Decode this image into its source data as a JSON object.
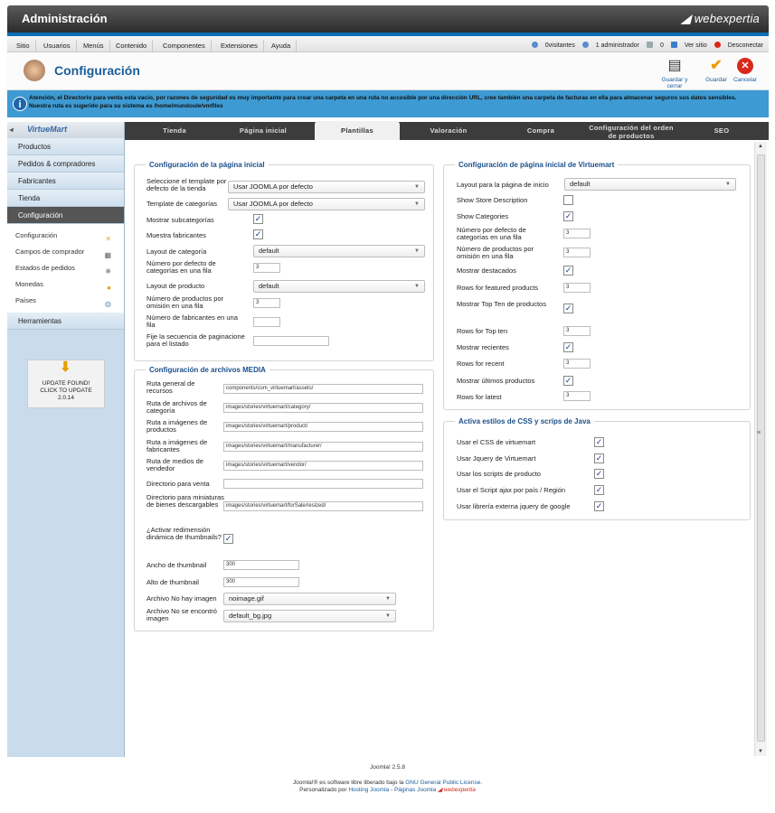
{
  "header": {
    "title": "Administración",
    "brand": "webexpertia"
  },
  "menu": {
    "items": [
      "Sitio",
      "Usuarios",
      "Menús",
      "Contenido",
      "Componentes",
      "Extensiones",
      "Ayuda"
    ],
    "visitors": "0visitantes",
    "admins": "1 administrador",
    "messages": "0",
    "view_site": "Ver sitio",
    "logout": "Desconectar"
  },
  "toolbar": {
    "title": "Configuración",
    "save_close": "Guardar y cerrar",
    "save": "Guardar",
    "cancel": "Cancelar"
  },
  "alert": {
    "text": "Atención, el Directorio para venta esta vacío, por razones de seguridad es muy importante para crear una carpeta en una ruta no accesible por una dirección URL, cree también una carpeta de facturas en ella para almacenar seguros sus datos sensibles. Nuestra ruta es sugerido para su sistema es /home/mundoule/vmfiles"
  },
  "sidebar": {
    "logo": "VirtueMart",
    "items": [
      "Productos",
      "Pedidos & compradores",
      "Fabricantes",
      "Tienda",
      "Configuración"
    ],
    "sub": [
      "Configuración",
      "Campos de comprador",
      "Estados de pedidos",
      "Monedas",
      "Países"
    ],
    "tools": "Herramientas",
    "update": {
      "line1": "UPDATE FOUND!",
      "line2": "CLICK TO UPDATE",
      "version": "2.0.14"
    }
  },
  "tabs": [
    "Tienda",
    "Página inicial",
    "Plantillas",
    "Valoración",
    "Compra",
    "Configuración del orden de productos",
    "SEO"
  ],
  "left": {
    "legend1": "Configuración de la página inicial",
    "store_template_label": "Seleccione el template por defecto de la tienda",
    "store_template_value": "Usar JOOMLA por defecto",
    "cat_template_label": "Template de categorías",
    "cat_template_value": "Usar JOOMLA por defecto",
    "show_subcats": "Mostrar subcategorías",
    "show_manufacturers": "Muestra fabricantes",
    "cat_layout_label": "Layout de categoría",
    "cat_layout_value": "default",
    "cats_per_row_label": "Número por defecto de categorías en una fila",
    "cats_per_row_value": "3",
    "product_layout_label": "Layout de producto",
    "product_layout_value": "default",
    "products_per_row_label": "Número de productos por omisión en una fila",
    "products_per_row_value": "3",
    "manu_per_row_label": "Número de fabricantes en una fila",
    "manu_per_row_value": "",
    "pagination_label": "Fije la secuencia de paginacione para el listado",
    "pagination_value": "",
    "legend2": "Configuración de archivos MEDIA",
    "assets_label": "Ruta general de recursos",
    "assets_value": "components/com_virtuemart/assets/",
    "cat_images_label": "Ruta de archivos de categoría",
    "cat_images_value": "images/stories/virtuemart/category/",
    "prod_images_label": "Ruta a imágenes de productos",
    "prod_images_value": "images/stories/virtuemart/product/",
    "manu_images_label": "Ruta a imágenes de fabricantes",
    "manu_images_value": "images/stories/virtuemart/manufacturer/",
    "vendor_media_label": "Ruta de medios de vendedor",
    "vendor_media_value": "images/stories/virtuemart/vendor/",
    "sale_dir_label": "Directorio para venta",
    "sale_dir_value": "",
    "thumb_dir_label": "Directorio para miniaturas de bienes descargables",
    "thumb_dir_value": "images/stories/virtuemart/forSale/resized/",
    "resize_label": "¿Activar redimensión dinámica de thumbnails?",
    "thumb_w_label": "Ancho de thumbnail",
    "thumb_w_value": "300",
    "thumb_h_label": "Alto de thumbnail",
    "thumb_h_value": "300",
    "noimage_label": "Archivo No hay imagen",
    "noimage_value": "noimage.gif",
    "notfound_label": "Archivo No se encontró imagen",
    "notfound_value": "default_bg.jpg"
  },
  "right": {
    "legend1": "Configuración de página inicial de Virtuemart",
    "layout_label": "Layout para la página de inicio",
    "layout_value": "default",
    "store_desc": "Show Store Description",
    "show_cats": "Show Categories",
    "cats_row_label": "Número por defecto de categorías en una fila",
    "cats_row_value": "3",
    "prods_row_label": "Número de productos por omisión en una fila",
    "prods_row_value": "3",
    "featured": "Mostrar destacados",
    "featured_rows_label": "Rows for featured products",
    "featured_rows_value": "3",
    "topten": "Mostrar Top Ten de productos",
    "topten_rows_label": "Rows for Top ten",
    "topten_rows_value": "3",
    "recent": "Mostrar recientes",
    "recent_rows_label": "Rows for recent",
    "recent_rows_value": "3",
    "latest": "Mostrar últimos productos",
    "latest_rows_label": "Rows for latest",
    "latest_rows_value": "3",
    "legend2": "Activa estilos de CSS y scrips de Java",
    "css": "Usar el CSS de virtuemart",
    "jquery": "Usar Jquery de Virtuemart",
    "prod_scripts": "Usar los scripts de producto",
    "ajax": "Usar el Script ajax por país / Región",
    "google_jquery": "Usar librería externa jquery de google"
  },
  "footer": {
    "version": "Joomla! 2.5.8",
    "line2_pre": "Joomla!® es software libre liberado bajo la",
    "line2_link": "GNU General Public License",
    "line3_pre": "Personalizado por",
    "line3_link1": "Hosting Joomla",
    "line3_sep": "-",
    "line3_link2": "Páginas Joomla",
    "brand": "webexpertia"
  },
  "colors": {
    "accent": "#0b6fb3",
    "alert": "#3e9ad2",
    "header": "#2c2c2c",
    "save_check": "#f09a00",
    "cancel": "#d9281b"
  }
}
